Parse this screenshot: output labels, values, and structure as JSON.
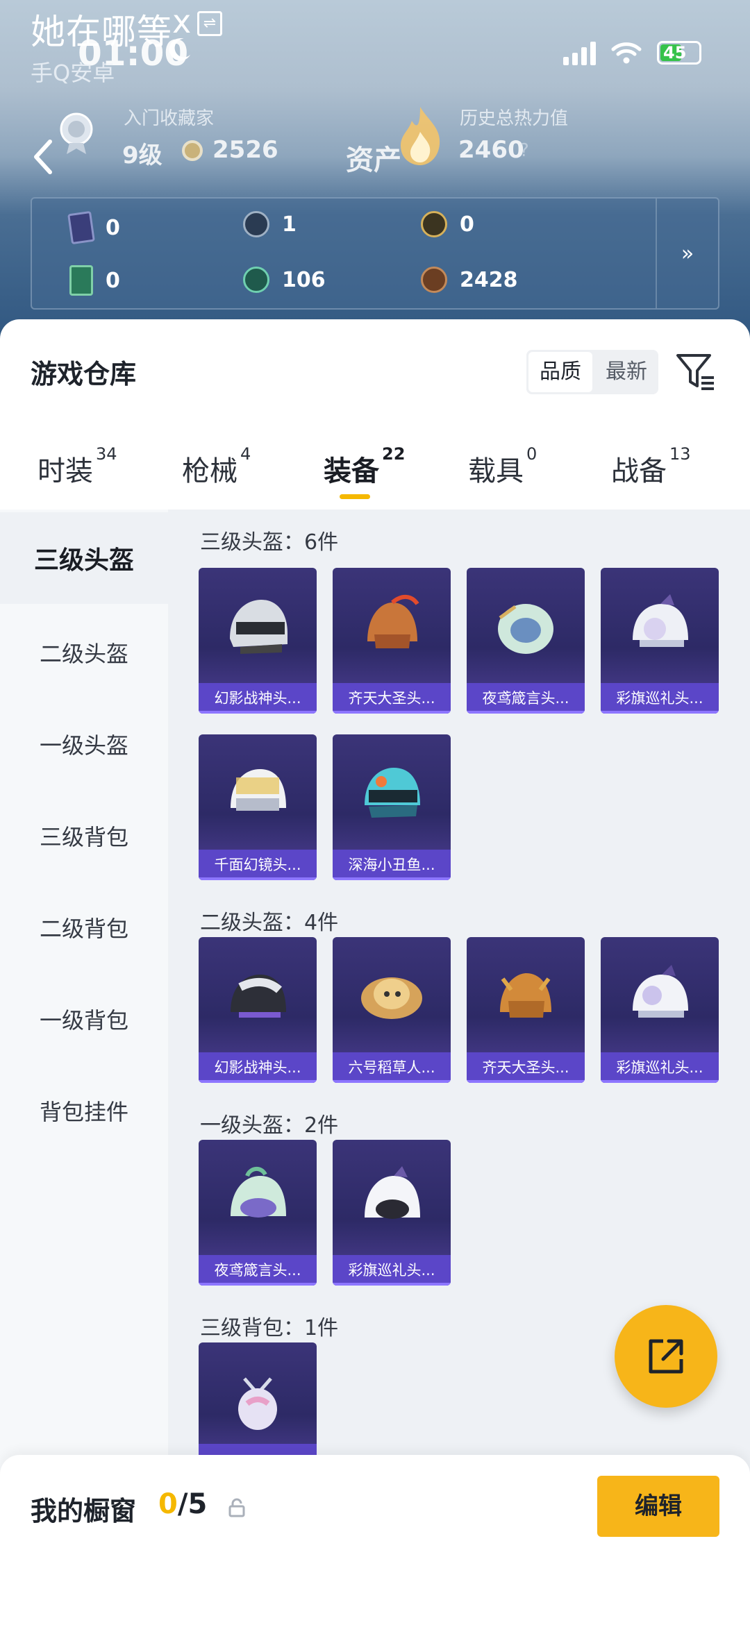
{
  "overlay": {
    "title": "她在哪等",
    "close": "x",
    "subtitle": "手Q安卓"
  },
  "status_bar": {
    "time": "01:00",
    "battery": "45"
  },
  "profile": {
    "level_label": "入门收藏家",
    "level_value": "9级",
    "coins": "2526",
    "assets_label": "资产",
    "heat_label": "历史总热力值",
    "heat_value": "2460",
    "help": "?"
  },
  "stats": [
    {
      "icon": "card-icon",
      "value": "0"
    },
    {
      "icon": "silver-coin-icon",
      "value": "1"
    },
    {
      "icon": "gold-coin-icon",
      "value": "0"
    },
    {
      "icon": "green-card-icon",
      "value": "0"
    },
    {
      "icon": "jade-coin-icon",
      "value": "106"
    },
    {
      "icon": "bronze-coin-icon",
      "value": "2428"
    }
  ],
  "stats_more": "»",
  "warehouse": {
    "title": "游戏仓库",
    "sort_quality": "品质",
    "sort_newest": "最新"
  },
  "tabs": [
    {
      "label": "时装",
      "count": "34"
    },
    {
      "label": "枪械",
      "count": "4"
    },
    {
      "label": "装备",
      "count": "22"
    },
    {
      "label": "载具",
      "count": "0"
    },
    {
      "label": "战备",
      "count": "13"
    }
  ],
  "sidebar": [
    {
      "label": "三级头盔"
    },
    {
      "label": "二级头盔"
    },
    {
      "label": "一级头盔"
    },
    {
      "label": "三级背包"
    },
    {
      "label": "二级背包"
    },
    {
      "label": "一级背包"
    },
    {
      "label": "背包挂件"
    }
  ],
  "sections": [
    {
      "title": "三级头盔：6件",
      "items": [
        "幻影战神头...",
        "齐天大圣头...",
        "夜鸢箴言头...",
        "彩旗巡礼头...",
        "千面幻镜头...",
        "深海小丑鱼..."
      ]
    },
    {
      "title": "二级头盔：4件",
      "items": [
        "幻影战神头...",
        "六号稻草人...",
        "齐天大圣头...",
        "彩旗巡礼头..."
      ]
    },
    {
      "title": "一级头盔：2件",
      "items": [
        "夜鸢箴言头...",
        "彩旗巡礼头..."
      ]
    },
    {
      "title": "三级背包：1件",
      "items": [
        ""
      ]
    }
  ],
  "showcase": {
    "label": "我的橱窗",
    "current": "0",
    "total": "/5",
    "edit": "编辑"
  },
  "colors": {
    "accent": "#f7b519",
    "card_bg": "#2d2a66",
    "card_label": "#5b46c8"
  }
}
